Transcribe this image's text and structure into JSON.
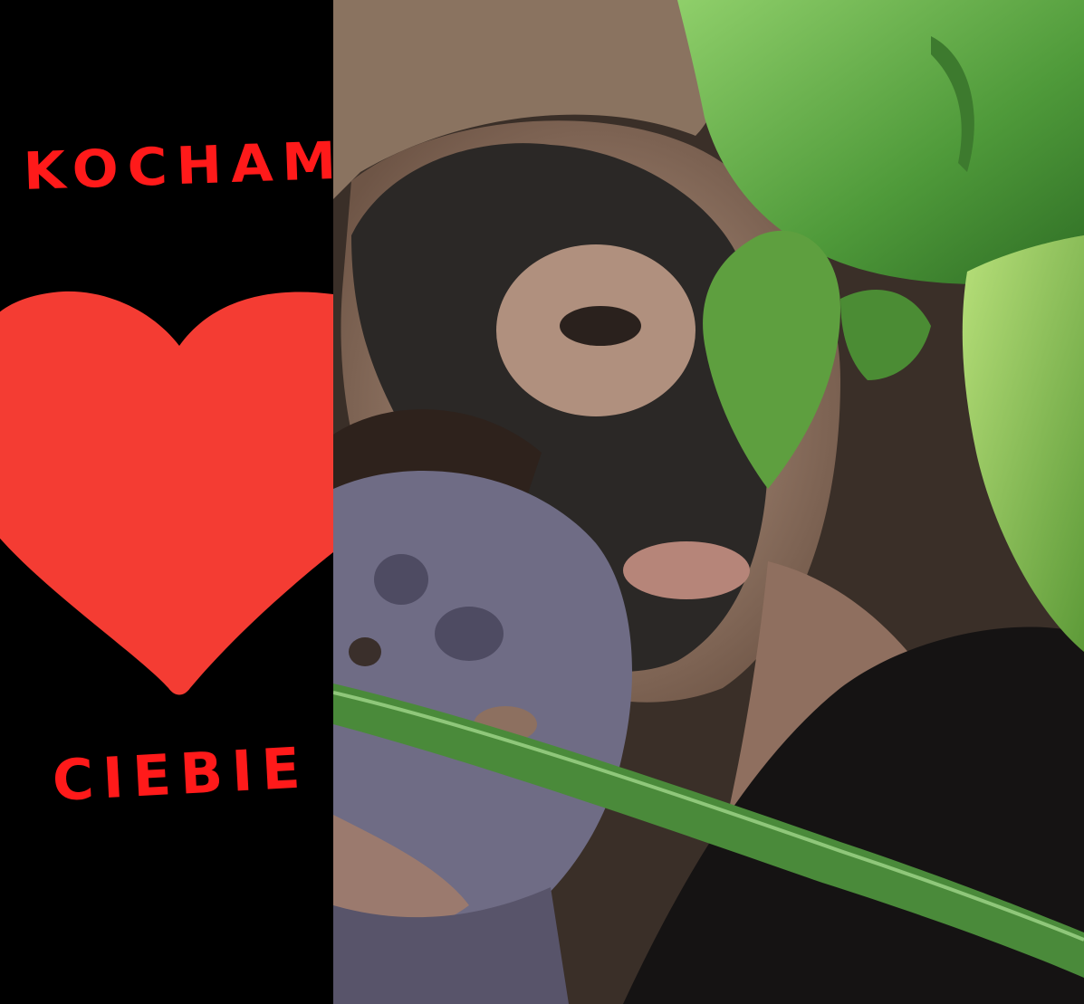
{
  "caption": {
    "top": "KOCHAM",
    "bottom": "CIEBIE"
  },
  "colors": {
    "background": "#000000",
    "text": "#ff1a1a",
    "heart": "#f43c33"
  },
  "icons": {
    "heart": "heart-icon"
  }
}
